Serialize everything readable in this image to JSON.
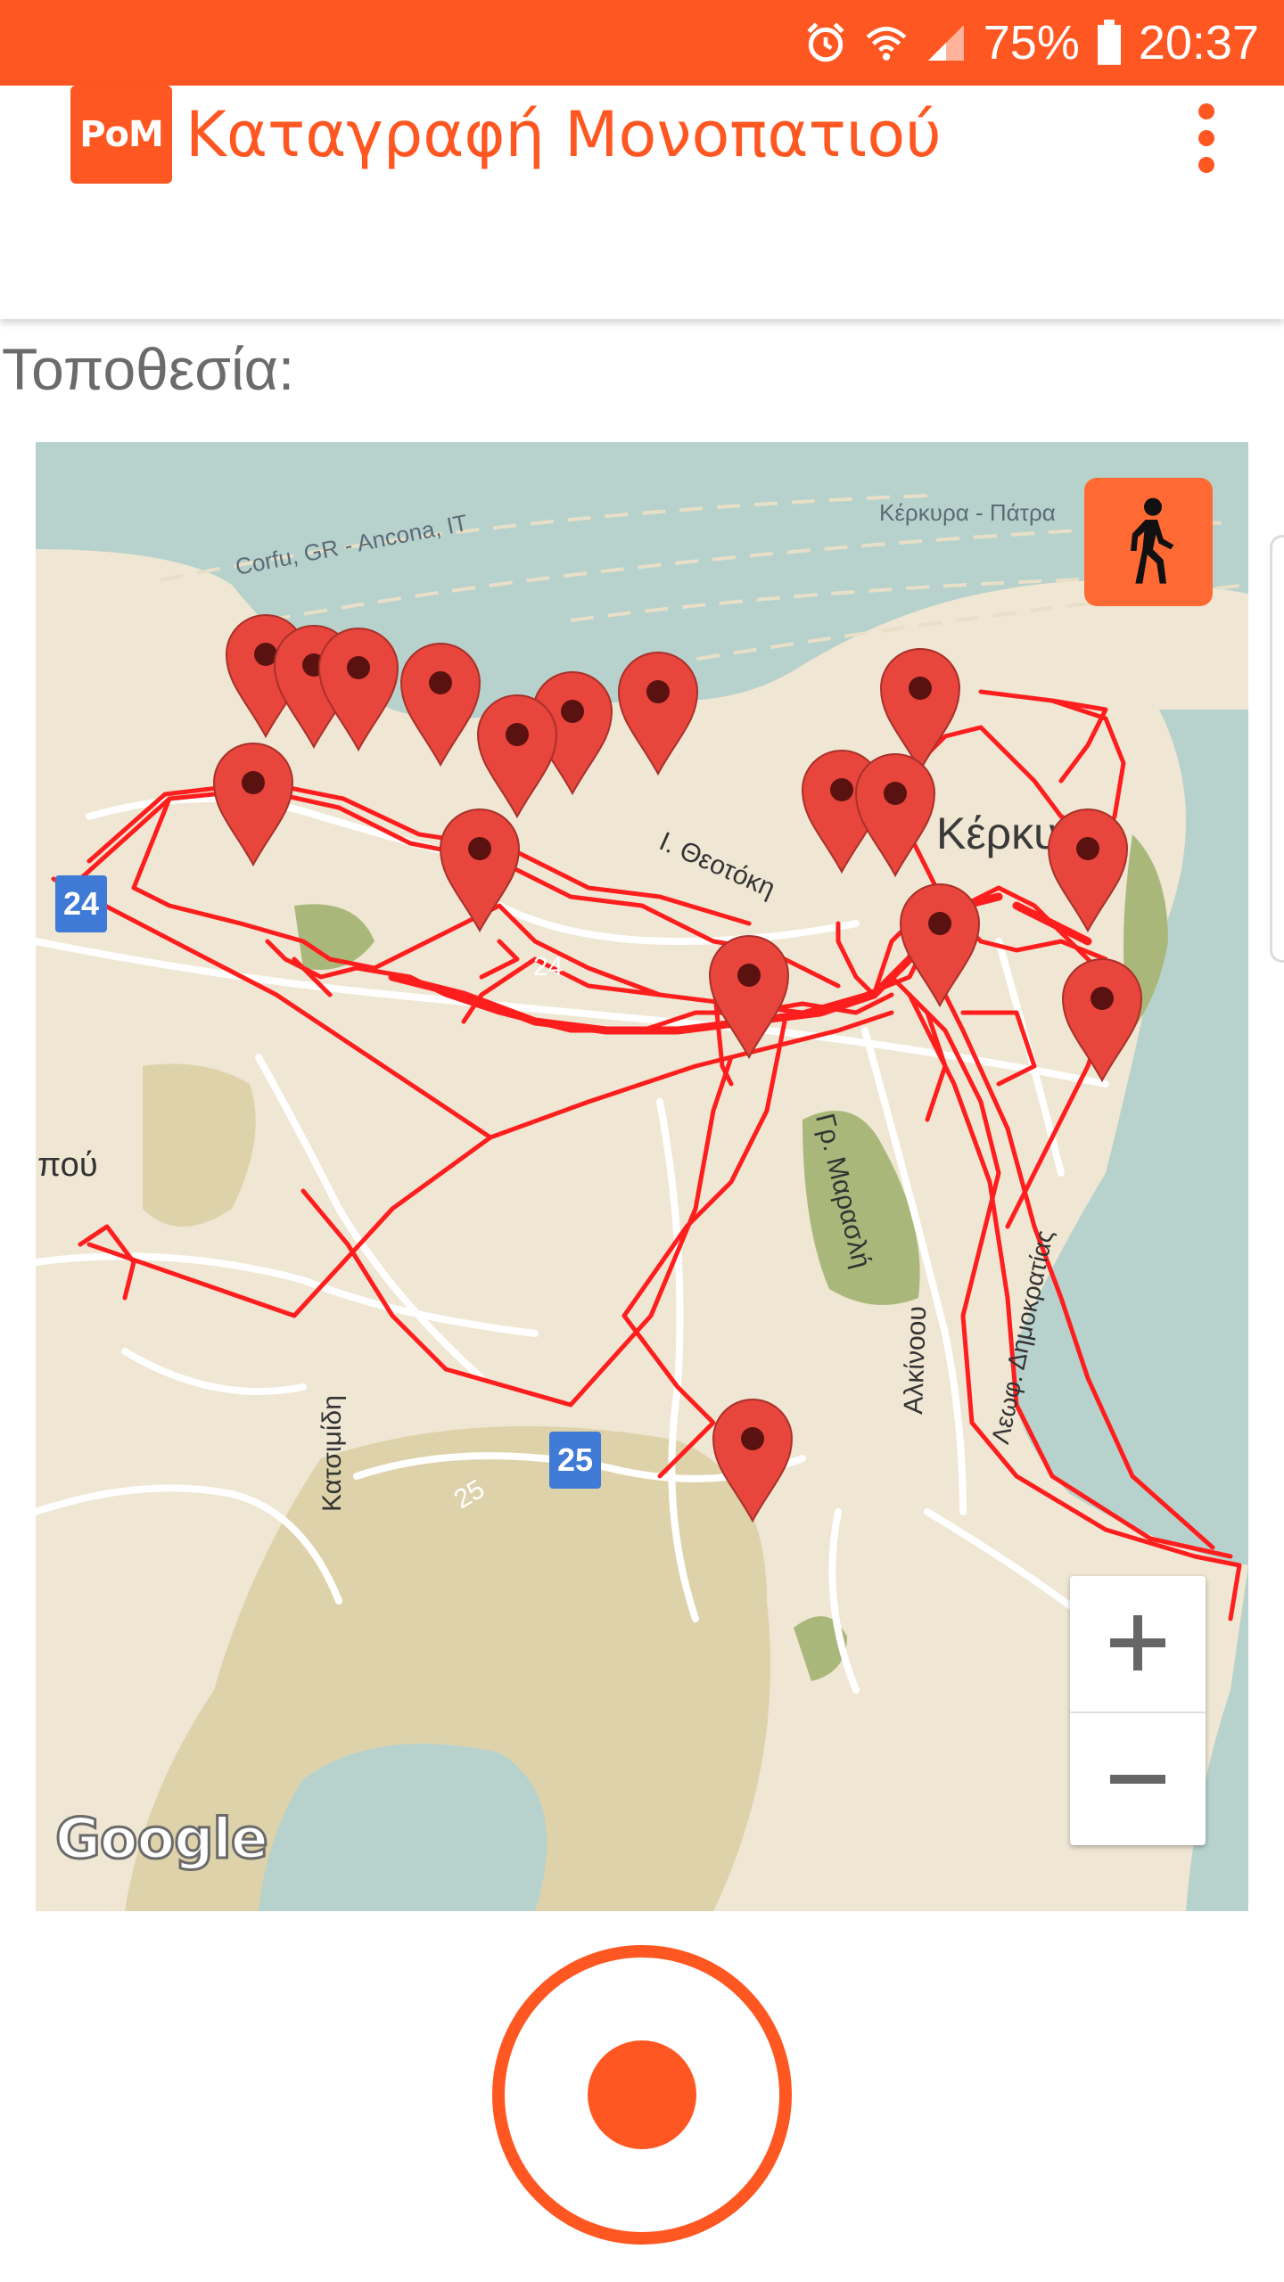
{
  "status_bar": {
    "battery": "75%",
    "time": "20:37",
    "icons": [
      "alarm-icon",
      "wifi-icon",
      "signal-icon",
      "battery-icon"
    ]
  },
  "app_bar": {
    "logo_text": "PoM",
    "title": "Καταγραφή Μονοπατιού",
    "menu_icon": "more-vert-icon"
  },
  "location_label": "Τοποθεσία:",
  "map": {
    "labels": {
      "ferry_north": "Corfu, GR - Ancona, IT",
      "ferry_east": "Κέρκυρα - Πάτρα",
      "city": "Κέρκυρα",
      "street_theotoki": "Ι. Θεοτόκη",
      "street_marasli": "Γρ. Μαρασλή",
      "street_alkinoou": "Αλκίνοου",
      "street_dimokratias": "Λεωφ. Δημοκρατίας",
      "street_katsimidi": "Κατσιμίδη",
      "place_west": "πού",
      "road_24": "24",
      "road_25": "25"
    },
    "road_shields": [
      "24",
      "25"
    ],
    "logo": "Google",
    "controls": {
      "walk_icon": "walking-person-icon",
      "zoom_in": "+",
      "zoom_out": "−"
    },
    "colors": {
      "track": "#ff1e1e",
      "marker": "#e8453c",
      "water": "#b7d2cc",
      "land": "#efe6d3",
      "park": "#a9b87a"
    }
  },
  "record_button": {
    "icon": "record-icon"
  },
  "colors": {
    "accent": "#ff5722"
  }
}
